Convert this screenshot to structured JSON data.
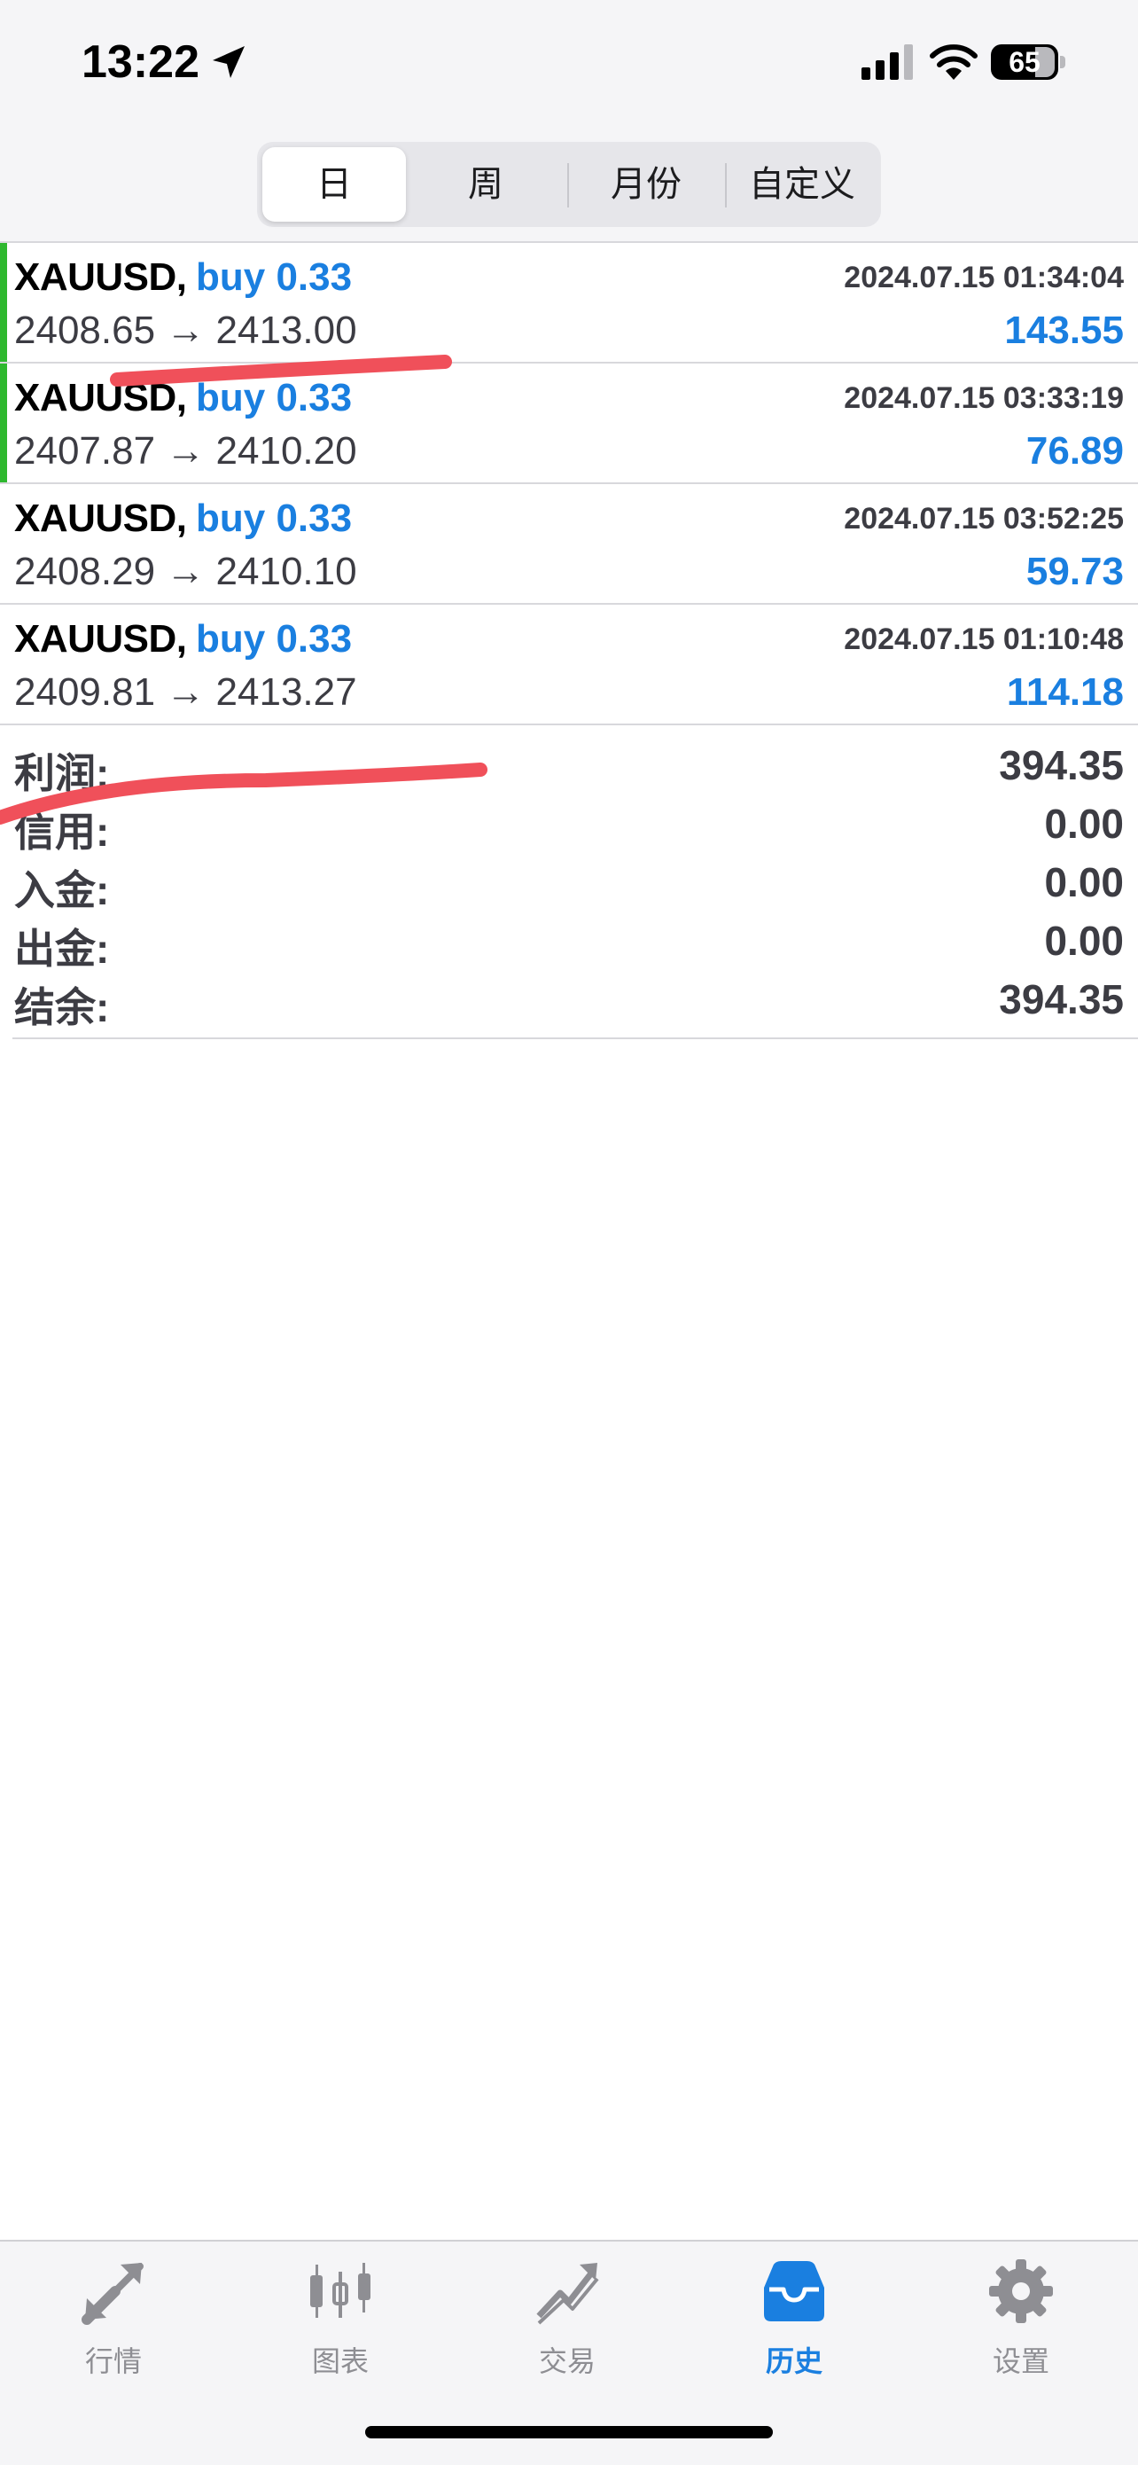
{
  "status_bar": {
    "time": "13:22",
    "battery": "65"
  },
  "segmented": {
    "tabs": [
      "日",
      "周",
      "月份",
      "自定义"
    ],
    "selected": "日"
  },
  "trades": [
    {
      "symbol": "XAUUSD,",
      "side": "buy 0.33",
      "open": "2408.65",
      "close": "2413.00",
      "date": "2024.07.15 01:34:04",
      "profit": "143.55"
    },
    {
      "symbol": "XAUUSD,",
      "side": "buy 0.33",
      "open": "2407.87",
      "close": "2410.20",
      "date": "2024.07.15 03:33:19",
      "profit": "76.89"
    },
    {
      "symbol": "XAUUSD,",
      "side": "buy 0.33",
      "open": "2408.29",
      "close": "2410.10",
      "date": "2024.07.15 03:52:25",
      "profit": "59.73"
    },
    {
      "symbol": "XAUUSD,",
      "side": "buy 0.33",
      "open": "2409.81",
      "close": "2413.27",
      "date": "2024.07.15 01:10:48",
      "profit": "114.18"
    }
  ],
  "price_arrow": "→",
  "summary": [
    {
      "label": "利润:",
      "value": "394.35"
    },
    {
      "label": "信用:",
      "value": "0.00"
    },
    {
      "label": "入金:",
      "value": "0.00"
    },
    {
      "label": "出金:",
      "value": "0.00"
    },
    {
      "label": "结余:",
      "value": "394.35"
    }
  ],
  "tabbar": {
    "items": [
      {
        "label": "行情",
        "icon": "quotes-arrows-icon"
      },
      {
        "label": "图表",
        "icon": "candlestick-chart-icon"
      },
      {
        "label": "交易",
        "icon": "trade-trend-icon"
      },
      {
        "label": "历史",
        "icon": "history-inbox-icon"
      },
      {
        "label": "设置",
        "icon": "gear-icon"
      }
    ],
    "active": "历史"
  },
  "colors": {
    "accent_blue": "#1a7fe0",
    "buy_bar_green": "#2eb82e",
    "annotation_red": "#f0505a",
    "tab_inactive": "#8e8e93"
  }
}
